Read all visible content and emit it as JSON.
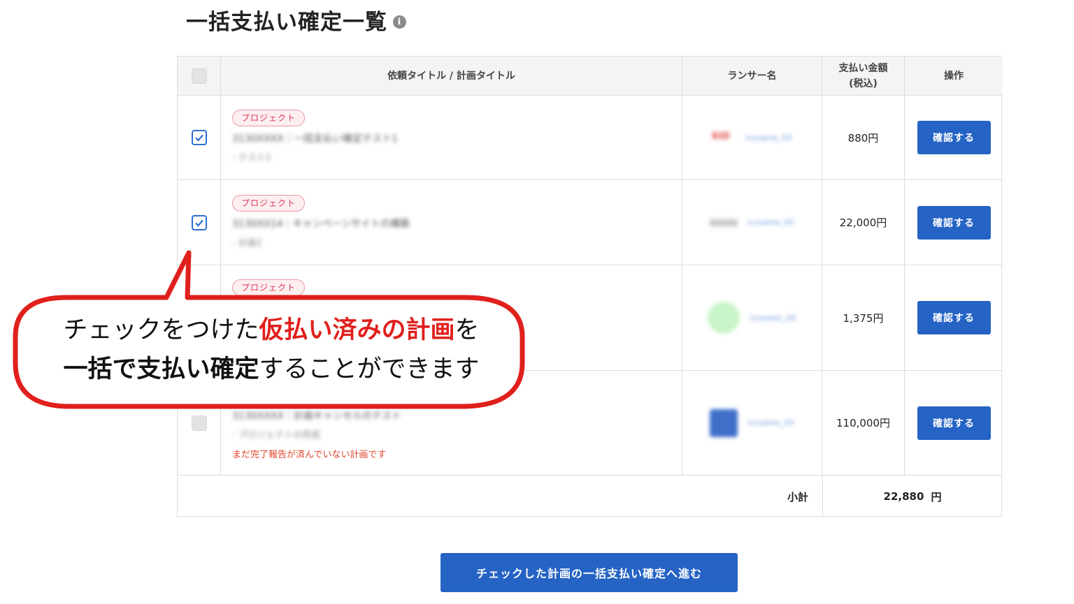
{
  "page": {
    "title": "一括支払い確定一覧",
    "info_icon": "info-icon"
  },
  "table": {
    "headers": {
      "title": "依頼タイトル / 計画タイトル",
      "lancer": "ランサー名",
      "amount_line1": "支払い金額",
      "amount_line2": "(税込)",
      "action": "操作"
    },
    "rows": [
      {
        "checked": true,
        "tag": "プロジェクト",
        "title": "3130XXXX｜一括支払い確定テスト1",
        "plan": "- テスト1",
        "lancer_name": "lcsname_XX",
        "amount": "880円",
        "button": "確認する"
      },
      {
        "checked": true,
        "tag": "プロジェクト",
        "title": "3130XX14｜キャンペーンサイトの構築",
        "plan": "- 計画1",
        "lancer_name": "lcsname_XX",
        "amount": "22,000円",
        "button": "確認する"
      },
      {
        "checked": false,
        "tag": "プロジェクト",
        "title": "",
        "plan": "",
        "lancer_name": "lcsname_XX",
        "amount": "1,375円",
        "button": "確認する"
      },
      {
        "checked": false,
        "tag": "",
        "title": "3130XXXX｜計画キャンセルのテスト",
        "plan": "- プロジェクトの完成",
        "warning": "まだ完了報告が済んでいない計画です",
        "lancer_name": "lcsname_XX",
        "amount": "110,000円",
        "button": "確認する"
      }
    ],
    "subtotal_label": "小計",
    "subtotal_value": "22,880",
    "subtotal_unit": "円"
  },
  "bulk_button": "チェックした計画の一括支払い確定へ進む",
  "callout": {
    "line1_a": "チェックをつけた",
    "line1_b": "仮払い済みの計画",
    "line1_c": "を",
    "line2_a": "一括で支払い確定",
    "line2_b": "することができます"
  },
  "colors": {
    "primary": "#2563c4",
    "tag_red": "#d9354f",
    "warning": "#e0452c",
    "callout_border": "#e0201c"
  }
}
